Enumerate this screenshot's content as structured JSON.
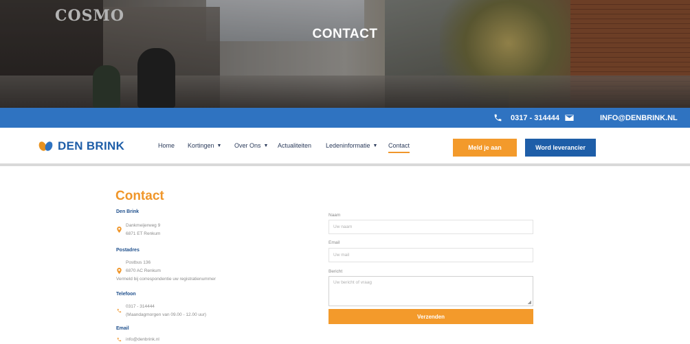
{
  "hero": {
    "title": "CONTACT",
    "sign_text": "COSMO"
  },
  "topbar": {
    "phone": "0317 - 314444",
    "email": "INFO@DENBRINK.NL"
  },
  "logo": {
    "text": "DEN BRINK"
  },
  "nav": {
    "items": [
      {
        "label": "Home",
        "dropdown": false
      },
      {
        "label": "Kortingen",
        "dropdown": true
      },
      {
        "label": "Over Ons",
        "dropdown": true
      },
      {
        "label": "Actualiteiten",
        "dropdown": false
      },
      {
        "label": "Ledeninformatie",
        "dropdown": true
      },
      {
        "label": "Contact",
        "dropdown": false,
        "active": true
      }
    ],
    "signup_button": "Meld je aan",
    "supplier_button": "Word leverancier"
  },
  "page": {
    "title": "Contact"
  },
  "contact": {
    "company_heading": "Den Brink",
    "address_line1": "Dankmeijerweg 9",
    "address_line2": "6871 ET Renkum",
    "postal_heading": "Postadres",
    "postal_line1": "Postbus 136",
    "postal_line2": "6870 AC Renkum",
    "postal_note": "Vermeld bij correspondentie uw registratienummer",
    "phone_heading": "Telefoon",
    "phone_number": "0317 - 314444",
    "phone_hours": "(Maandagmorgen van 09.00 - 12.00 uur)",
    "email_heading": "Email",
    "email_address": "info@denbrink.nl"
  },
  "form": {
    "name_label": "Naam",
    "name_placeholder": "Uw naam",
    "email_label": "Email",
    "email_placeholder": "Uw mail",
    "message_label": "Bericht",
    "message_placeholder": "Uw bericht of vraag",
    "submit_label": "Verzenden"
  },
  "colors": {
    "primary_blue": "#2f73c1",
    "accent_orange": "#f39a2b",
    "logo_blue": "#1e5ea8"
  },
  "icons": {
    "phone": "phone-icon",
    "mail": "envelope-icon",
    "location": "map-pin-icon"
  }
}
